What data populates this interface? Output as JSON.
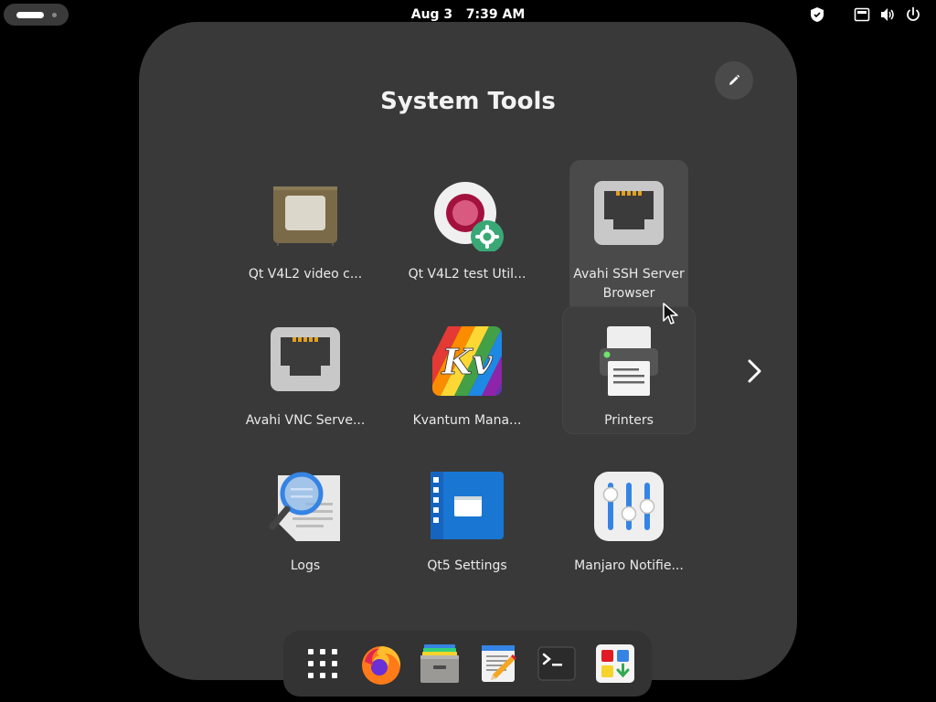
{
  "topbar": {
    "clock": "Aug 3   7:39 AM"
  },
  "folder": {
    "title": "System Tools",
    "apps": [
      {
        "label": "Qt V4L2 video c...",
        "icon": "video-capture-icon"
      },
      {
        "label": "Qt V4L2 test Util...",
        "icon": "webcam-settings-icon"
      },
      {
        "label": "Avahi SSH Server Browser",
        "icon": "network-port-icon"
      },
      {
        "label": "Avahi VNC Serve...",
        "icon": "network-port-icon"
      },
      {
        "label": "Kvantum Mana...",
        "icon": "kvantum-icon"
      },
      {
        "label": "Printers",
        "icon": "printer-icon"
      },
      {
        "label": "Logs",
        "icon": "logs-icon"
      },
      {
        "label": "Qt5 Settings",
        "icon": "qt-settings-icon"
      },
      {
        "label": "Manjaro Notifie...",
        "icon": "mixer-sliders-icon"
      }
    ]
  },
  "dock": {
    "items": [
      "show-apps-icon",
      "firefox-icon",
      "file-cabinet-icon",
      "text-editor-icon",
      "terminal-icon",
      "software-store-icon"
    ]
  },
  "colors": {
    "folder_bg": "#393939",
    "dock_bg": "#333333",
    "accent_blue": "#3584e4"
  }
}
